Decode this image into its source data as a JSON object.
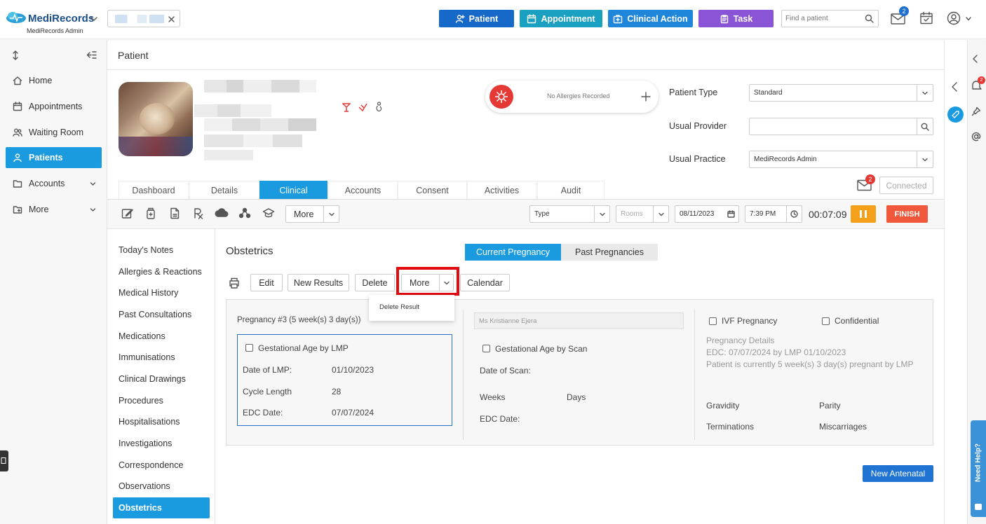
{
  "app": {
    "logo": "MediRecords",
    "logo_sub": "MediRecords Admin"
  },
  "topbar": {
    "patient_btn": "Patient",
    "appointment_btn": "Appointment",
    "clinical_action_btn": "Clinical Action",
    "task_btn": "Task",
    "search_placeholder": "Find a patient",
    "mail_count": "2",
    "colors": {
      "patient": "#1769c9",
      "appointment": "#1aa0c0",
      "clinical": "#1f86d9",
      "task": "#8a54d6"
    }
  },
  "sidebar": {
    "items": [
      {
        "label": "Home"
      },
      {
        "label": "Appointments"
      },
      {
        "label": "Waiting Room"
      },
      {
        "label": "Patients"
      },
      {
        "label": "Accounts"
      },
      {
        "label": "More"
      }
    ]
  },
  "page": {
    "title": "Patient"
  },
  "allergy": {
    "text": "No Allergies Recorded"
  },
  "patient_fields": {
    "type_label": "Patient Type",
    "type_value": "Standard",
    "provider_label": "Usual Provider",
    "provider_value": "",
    "practice_label": "Usual Practice",
    "practice_value": "MediRecords Admin"
  },
  "tabs": [
    "Dashboard",
    "Details",
    "Clinical",
    "Accounts",
    "Consent",
    "Activities",
    "Audit"
  ],
  "connected": {
    "label": "Connected",
    "msg_count": "2"
  },
  "toolbar": {
    "more": "More",
    "type_placeholder": "Type",
    "rooms_placeholder": "Rooms",
    "date": "08/11/2023",
    "time": "7:39 PM",
    "timer": "00:07:09",
    "finish": "FINISH"
  },
  "clinical_nav": [
    "Today's Notes",
    "Allergies & Reactions",
    "Medical History",
    "Past Consultations",
    "Medications",
    "Immunisations",
    "Clinical Drawings",
    "Procedures",
    "Hospitalisations",
    "Investigations",
    "Correspondence",
    "Observations",
    "Obstetrics"
  ],
  "obstetrics": {
    "title": "Obstetrics",
    "current_tab": "Current Pregnancy",
    "past_tab": "Past Pregnancies",
    "actions": {
      "edit": "Edit",
      "new_results": "New Results",
      "delete": "Delete",
      "more": "More",
      "calendar": "Calendar"
    },
    "dropdown": {
      "delete_result": "Delete Result"
    },
    "pregnancy_label": "Pregnancy #3 (5 week(s) 3 day(s))",
    "provider": "Ms Kristianne Ejera",
    "lmp": {
      "check_label": "Gestational Age by LMP",
      "date_label": "Date of LMP:",
      "date_value": "01/10/2023",
      "cycle_label": "Cycle Length",
      "cycle_value": "28",
      "edc_label": "EDC Date:",
      "edc_value": "07/07/2024"
    },
    "scan": {
      "check_label": "Gestational Age by Scan",
      "date_label": "Date of Scan:",
      "weeks_label": "Weeks",
      "days_label": "Days",
      "edc_label": "EDC Date:"
    },
    "right": {
      "ivf": "IVF Pregnancy",
      "confidential": "Confidential",
      "details_title": "Pregnancy Details",
      "details_line1": "EDC: 07/07/2024 by LMP 01/10/2023",
      "details_line2": "Patient is currently 5 week(s) 3 day(s) pregnant by LMP",
      "gravidity": "Gravidity",
      "parity": "Parity",
      "terminations": "Terminations",
      "miscarriages": "Miscarriages"
    },
    "new_antenatal": "New Antenatal"
  },
  "help": {
    "label": "Need Help?"
  }
}
